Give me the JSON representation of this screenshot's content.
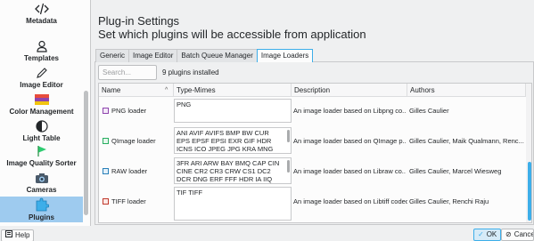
{
  "sidebar": {
    "items": [
      {
        "label": "Metadata",
        "icon": "code-icon"
      },
      {
        "label": "Templates",
        "icon": "user-icon"
      },
      {
        "label": "Image Editor",
        "icon": "pencil-icon"
      },
      {
        "label": "Color Management",
        "icon": "color-palette-icon"
      },
      {
        "label": "Light Table",
        "icon": "contrast-icon"
      },
      {
        "label": "Image Quality Sorter",
        "icon": "flag-icon"
      },
      {
        "label": "Cameras",
        "icon": "camera-icon"
      },
      {
        "label": "Plugins",
        "icon": "puzzle-icon"
      }
    ],
    "active_label": "Plugins"
  },
  "header": {
    "title": "Plug-in Settings",
    "subtitle": "Set which plugins will be accessible from application"
  },
  "tabs": [
    {
      "label": "Generic"
    },
    {
      "label": "Image Editor"
    },
    {
      "label": "Batch Queue Manager"
    },
    {
      "label": "Image Loaders"
    }
  ],
  "active_tab": "Image Loaders",
  "search": {
    "placeholder": "Search...",
    "value": ""
  },
  "plugin_count": "9 plugins installed",
  "table": {
    "columns": [
      "Name",
      "Type-Mimes",
      "Description",
      "Authors"
    ],
    "sort_indicator": "^",
    "rows": [
      {
        "name": "PNG loader",
        "checked": true,
        "mimes": "PNG",
        "description": "An image loader based on Libpng co...",
        "authors": "Gilles Caulier"
      },
      {
        "name": "QImage loader",
        "checked": true,
        "mimes": "ANI AVIF AVIFS BMP BW CUR EPS EPSF EPSI EXR GIF HDR ICNS ICO JPEG JPG KRA MNG",
        "description": "An image loader based on QImage p...",
        "authors": "Gilles Caulier, Maik Qualmann, Renc..."
      },
      {
        "name": "RAW loader",
        "checked": true,
        "mimes": "3FR ARI ARW BAY BMQ CAP CIN CINE CR2 CR3 CRW CS1 DC2 DCR DNG ERF FFF HDR IA IIQ",
        "description": "An image loader based on Libraw co...",
        "authors": "Gilles Caulier, Marcel Wiesweg"
      },
      {
        "name": "TIFF loader",
        "checked": true,
        "mimes": "TIF TIFF",
        "description": "An image loader based on Libtiff codec",
        "authors": "Gilles Caulier, Renchi Raju"
      }
    ]
  },
  "footer": {
    "help_label": "Help",
    "ok_label": "OK",
    "cancel_label": "Cancel"
  },
  "colors": {
    "accent": "#3daee9",
    "selection": "#9ecbef",
    "check_png": "#8e44ad",
    "check_qimage": "#27ae60",
    "check_raw": "#2980b9",
    "check_tiff": "#c0392b"
  }
}
